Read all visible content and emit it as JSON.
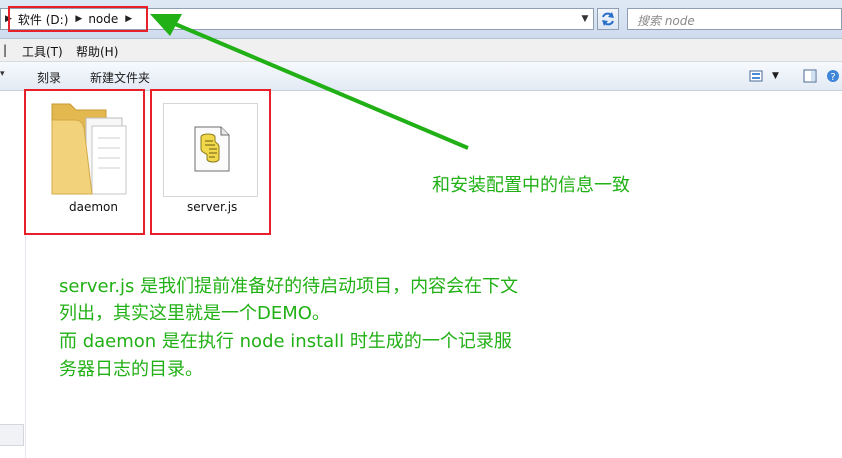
{
  "address_bar": {
    "crumbs": [
      "软件 (D:)",
      "node"
    ],
    "search_placeholder": "搜索 node"
  },
  "menu": {
    "items": [
      "工具(T)",
      "帮助(H)"
    ]
  },
  "command_bar": {
    "items": [
      "刻录",
      "新建文件夹"
    ]
  },
  "files": [
    {
      "name": "daemon",
      "type": "folder",
      "icon": "folder-icon"
    },
    {
      "name": "server.js",
      "type": "script",
      "icon": "script-file-icon"
    }
  ],
  "annotations": {
    "arrow_note": "和安装配置中的信息一致",
    "description_lines": [
      "server.js 是我们提前准备好的待启动项目，内容会在下文",
      "列出，其实这里就是一个DEMO。",
      "而 daemon 是在执行 node install 时生成的一个记录服",
      "务器日志的目录。"
    ]
  },
  "colors": {
    "annotation_green": "#21b015",
    "highlight_red": "#e8202a",
    "folder_yellow": "#f2d27a"
  }
}
